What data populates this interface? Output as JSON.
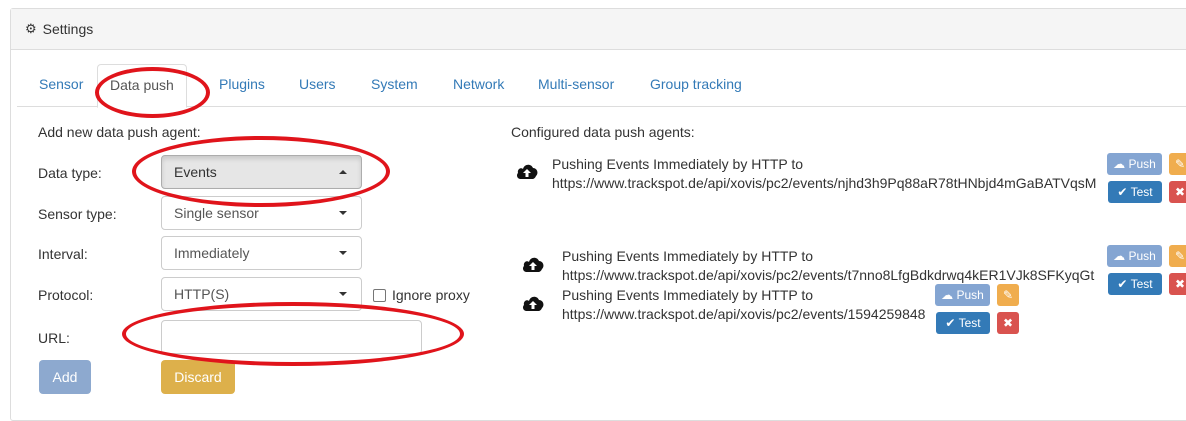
{
  "header": {
    "title": "Settings",
    "icon": "gears-icon"
  },
  "tabs": [
    "Sensor",
    "Data push",
    "Plugins",
    "Users",
    "System",
    "Network",
    "Multi-sensor",
    "Group tracking"
  ],
  "active_tab": "Data push",
  "form": {
    "title": "Add new data push agent:",
    "data_type": {
      "label": "Data type:",
      "value": "Events"
    },
    "sensor_type": {
      "label": "Sensor type:",
      "value": "Single sensor"
    },
    "interval": {
      "label": "Interval:",
      "value": "Immediately"
    },
    "protocol": {
      "label": "Protocol:",
      "value": "HTTP(S)"
    },
    "ignore_proxy": {
      "label": "Ignore proxy",
      "checked": false
    },
    "url": {
      "label": "URL:",
      "value": ""
    },
    "add_label": "Add",
    "discard_label": "Discard"
  },
  "configured": {
    "title": "Configured data push agents:",
    "agents": [
      {
        "line1": "Pushing Events Immediately by HTTP to",
        "line2": "https://www.trackspot.de/api/xovis/pc2/events/njhd3h9Pq88aR78tHNbjd4mGaBATVqsM"
      },
      {
        "line1": "Pushing Events Immediately by HTTP to",
        "line2": "https://www.trackspot.de/api/xovis/pc2/events/t7nno8LfgBdkdrwq4kER1VJk8SFKyqGt"
      },
      {
        "line1": "Pushing Events Immediately by HTTP to",
        "line2": "https://www.trackspot.de/api/xovis/pc2/events/1594259848"
      }
    ],
    "push_label": "Push",
    "test_label": "Test",
    "edit_icon": "edit-icon",
    "delete_icon": "delete-icon"
  },
  "colors": {
    "link": "#337ab7",
    "annotation": "#e0141b",
    "warning": "#ddb04b",
    "danger": "#d9534f"
  }
}
